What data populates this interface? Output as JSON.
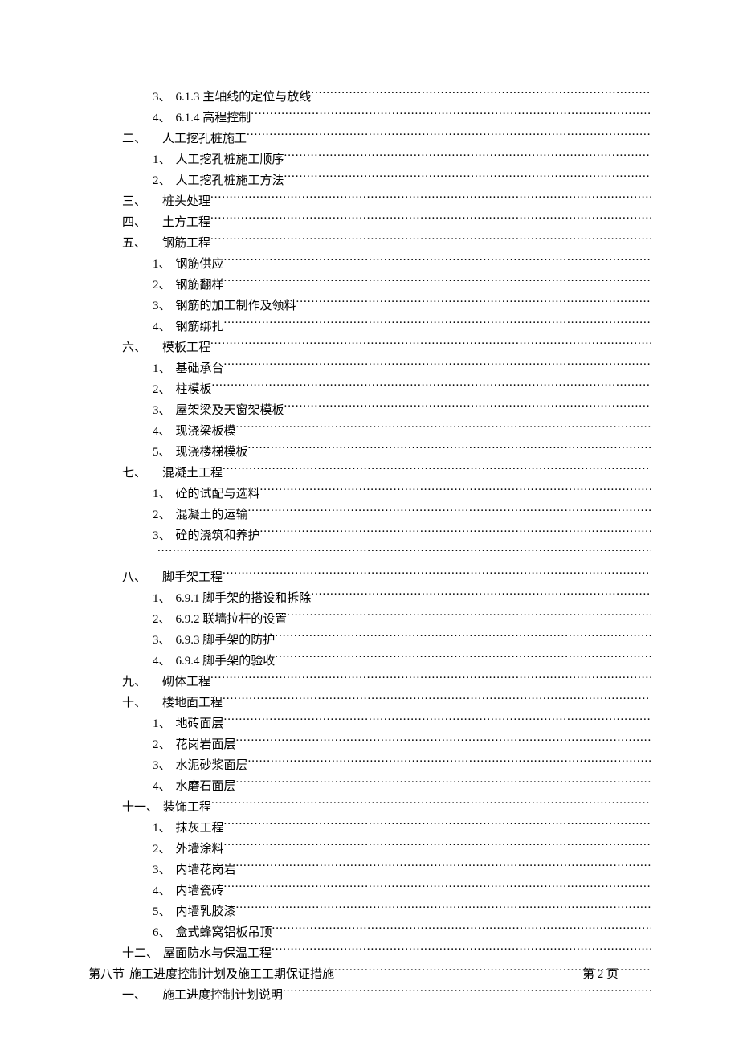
{
  "toc": [
    {
      "level": 2,
      "num": "3、",
      "label": "6.1.3 主轴线的定位与放线"
    },
    {
      "level": 2,
      "num": "4、",
      "label": "6.1.4 高程控制"
    },
    {
      "level": 1,
      "num": "二、",
      "label": "人工挖孔桩施工"
    },
    {
      "level": 2,
      "num": "1、",
      "label": "人工挖孔桩施工顺序"
    },
    {
      "level": 2,
      "num": "2、",
      "label": "人工挖孔桩施工方法"
    },
    {
      "level": 1,
      "num": "三、",
      "label": "桩头处理"
    },
    {
      "level": 1,
      "num": "四、",
      "label": "土方工程"
    },
    {
      "level": 1,
      "num": "五、",
      "label": "钢筋工程"
    },
    {
      "level": 2,
      "num": "1、",
      "label": "钢筋供应"
    },
    {
      "level": 2,
      "num": "2、",
      "label": "钢筋翻样"
    },
    {
      "level": 2,
      "num": "3、",
      "label": "钢筋的加工制作及领料"
    },
    {
      "level": 2,
      "num": "4、",
      "label": "钢筋绑扎"
    },
    {
      "level": 1,
      "num": "六、",
      "label": "模板工程"
    },
    {
      "level": 2,
      "num": "1、",
      "label": "基础承台"
    },
    {
      "level": 2,
      "num": "2、",
      "label": "柱模板"
    },
    {
      "level": 2,
      "num": "3、",
      "label": "屋架梁及天窗架模板"
    },
    {
      "level": 2,
      "num": "4、",
      "label": "现浇梁板模"
    },
    {
      "level": 2,
      "num": "5、",
      "label": "现浇楼梯模板"
    },
    {
      "level": 1,
      "num": "七、",
      "label": "混凝土工程"
    },
    {
      "level": 2,
      "num": "1、",
      "label": "砼的试配与选料"
    },
    {
      "level": 2,
      "num": "2、",
      "label": "混凝土的运输"
    },
    {
      "level": 2,
      "num": "3、",
      "label": "砼的浇筑和养护"
    },
    {
      "level": 2,
      "num": "",
      "label": ""
    },
    {
      "level": 1,
      "num": "八、",
      "label": "脚手架工程"
    },
    {
      "level": 2,
      "num": "1、",
      "label": "6.9.1 脚手架的搭设和拆除"
    },
    {
      "level": 2,
      "num": "2、",
      "label": "6.9.2 联墙拉杆的设置"
    },
    {
      "level": 2,
      "num": "3、",
      "label": "6.9.3 脚手架的防护"
    },
    {
      "level": 2,
      "num": "4、",
      "label": "6.9.4 脚手架的验收"
    },
    {
      "level": 1,
      "num": "九、",
      "label": "砌体工程"
    },
    {
      "level": 1,
      "num": "十、",
      "label": "楼地面工程"
    },
    {
      "level": 2,
      "num": "1、",
      "label": "地砖面层"
    },
    {
      "level": 2,
      "num": "2、",
      "label": "花岗岩面层"
    },
    {
      "level": 2,
      "num": "3、",
      "label": "水泥砂浆面层"
    },
    {
      "level": 2,
      "num": "4、",
      "label": "水磨石面层"
    },
    {
      "level": 1,
      "num": "十一、",
      "label": "装饰工程"
    },
    {
      "level": 2,
      "num": "1、",
      "label": "抹灰工程"
    },
    {
      "level": 2,
      "num": "2、",
      "label": "外墙涂料"
    },
    {
      "level": 2,
      "num": "3、",
      "label": "内墙花岗岩"
    },
    {
      "level": 2,
      "num": "4、",
      "label": "内墙瓷砖"
    },
    {
      "level": 2,
      "num": "5、",
      "label": "内墙乳胶漆"
    },
    {
      "level": 2,
      "num": "6、",
      "label": "盒式蜂窝铝板吊顶"
    },
    {
      "level": 1,
      "num": "十二、",
      "label": "屋面防水与保温工程"
    },
    {
      "level": 0,
      "num": "第八节",
      "label": " 施工进度控制计划及施工工期保证措施"
    },
    {
      "level": 1,
      "num": "一、",
      "label": "施工进度控制计划说明"
    }
  ],
  "footer": "第 2 页"
}
